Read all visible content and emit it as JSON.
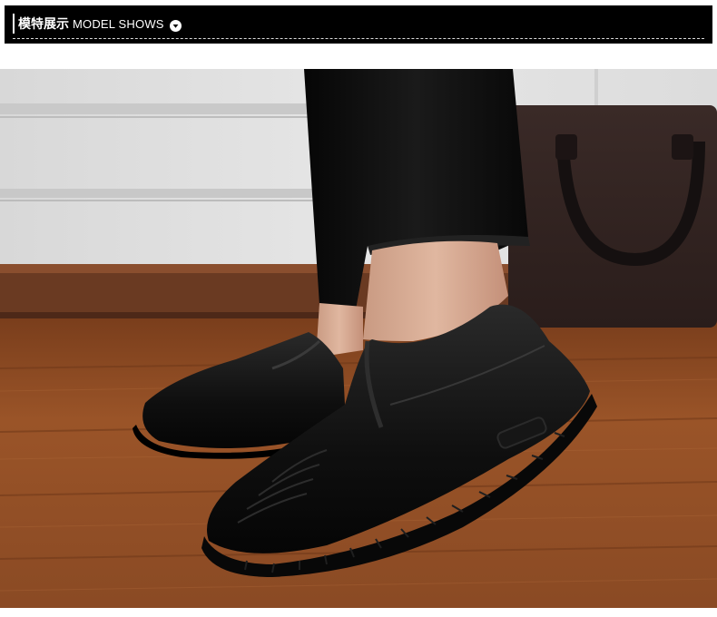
{
  "section_header": {
    "title_cn": "模特展示",
    "title_en": "MODEL SHOWS",
    "toggle_icon": "chevron-down-circle-icon"
  },
  "model_photo": {
    "subject": "black-leather-slip-on-shoes-photo"
  },
  "colors": {
    "header_bg": "#000000",
    "header_text": "#ffffff",
    "floor": "#8a4a24",
    "shoe": "#101010"
  }
}
